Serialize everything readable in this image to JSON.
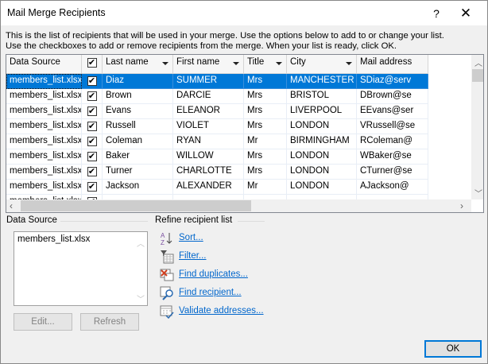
{
  "window": {
    "title": "Mail Merge Recipients",
    "help": "?",
    "close": "✕"
  },
  "intro": [
    "This is the list of recipients that will be used in your merge.  Use the options below to add to or change your list.",
    "Use the checkboxes to add or remove recipients from the merge.  When your list is ready, click OK."
  ],
  "grid": {
    "columns": [
      "Data Source",
      "",
      "Last name",
      "First name",
      "Title",
      "City",
      "Mail address"
    ],
    "rows": [
      {
        "source": "members_list.xlsx",
        "checked": true,
        "last": "Diaz",
        "first": "SUMMER",
        "title": "Mrs",
        "city": "MANCHESTER",
        "mail": "SDiaz@serv",
        "selected": true
      },
      {
        "source": "members_list.xlsx",
        "checked": true,
        "last": "Brown",
        "first": "DARCIE",
        "title": "Mrs",
        "city": "BRISTOL",
        "mail": "DBrown@se"
      },
      {
        "source": "members_list.xlsx",
        "checked": true,
        "last": "Evans",
        "first": "ELEANOR",
        "title": "Mrs",
        "city": "LIVERPOOL",
        "mail": "EEvans@ser"
      },
      {
        "source": "members_list.xlsx",
        "checked": true,
        "last": "Russell",
        "first": "VIOLET",
        "title": "Mrs",
        "city": "LONDON",
        "mail": "VRussell@se"
      },
      {
        "source": "members_list.xlsx",
        "checked": true,
        "last": "Coleman",
        "first": "RYAN",
        "title": "Mr",
        "city": "BIRMINGHAM",
        "mail": "RColeman@"
      },
      {
        "source": "members_list.xlsx",
        "checked": true,
        "last": "Baker",
        "first": "WILLOW",
        "title": "Mrs",
        "city": "LONDON",
        "mail": "WBaker@se"
      },
      {
        "source": "members_list.xlsx",
        "checked": true,
        "last": "Turner",
        "first": "CHARLOTTE",
        "title": "Mrs",
        "city": "LONDON",
        "mail": "CTurner@se"
      },
      {
        "source": "members_list.xlsx",
        "checked": true,
        "last": "Jackson",
        "first": "ALEXANDER",
        "title": "Mr",
        "city": "LONDON",
        "mail": "AJackson@"
      },
      {
        "source": "members_list.xlsx",
        "checked": true,
        "last": "",
        "first": "",
        "title": "",
        "city": "",
        "mail": ""
      }
    ]
  },
  "data_source": {
    "label": "Data Source",
    "items": [
      "members_list.xlsx"
    ],
    "edit": "Edit...",
    "refresh": "Refresh"
  },
  "refine": {
    "label": "Refine recipient list",
    "links": [
      "Sort...",
      "Filter...",
      "Find duplicates...",
      "Find recipient...",
      "Validate addresses..."
    ]
  },
  "ok": "OK",
  "colors": {
    "selection": "#0078d7",
    "link": "#0066cc"
  }
}
